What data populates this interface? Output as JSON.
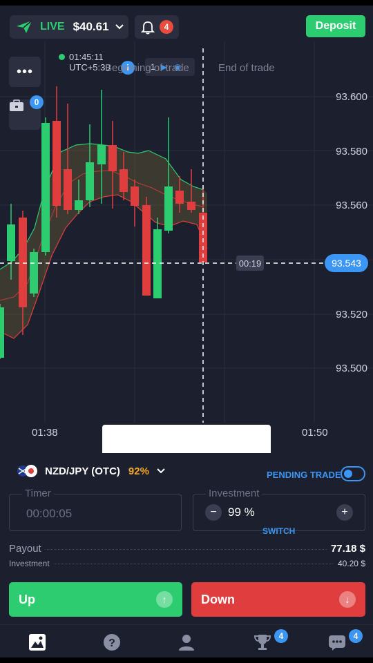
{
  "header": {
    "mode": "LIVE",
    "balance": "$40.61",
    "notifications_count": "4",
    "deposit_label": "Deposit"
  },
  "chart": {
    "time": "01:45:11",
    "timezone": "UTC+5:30",
    "trade_start_label": "Beginning of trade",
    "trade_end_label": "End of trade",
    "marker_count": "1",
    "y_ticks": [
      "93.600",
      "93.580",
      "93.560",
      "93.520",
      "93.500"
    ],
    "x_ticks": [
      "01:38",
      "01:50"
    ],
    "current_price": "93.543",
    "countdown": "00:19",
    "portfolio_count": "0"
  },
  "trade": {
    "pair": "NZD/JPY (OTC)",
    "payout_percent": "92%",
    "pending_label": "PENDING TRADE",
    "timer_label": "Timer",
    "timer_value": "00:00:05",
    "investment_label": "Investment",
    "investment_value": "99 %",
    "switch_label": "SWITCH",
    "payout_label": "Payout",
    "payout_value": "77.18 $",
    "investment_row_label": "Investment",
    "investment_row_value": "40.20 $",
    "up_label": "Up",
    "down_label": "Down"
  },
  "nav": {
    "trophy_badge": "4",
    "chat_badge": "4"
  },
  "colors": {
    "background": "#1c1f2d",
    "up": "#2ecc71",
    "down": "#e03e3e",
    "accent": "#3b96f5",
    "payout": "#f5a623"
  }
}
